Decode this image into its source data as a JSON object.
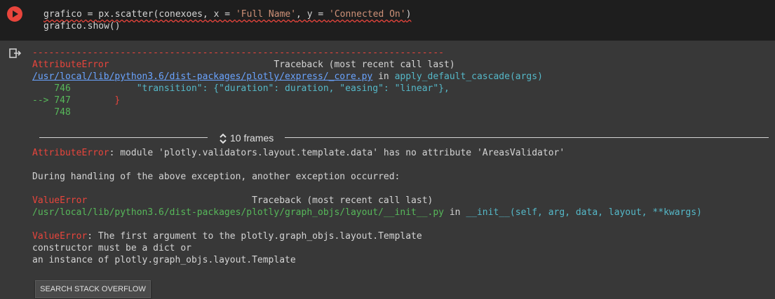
{
  "code_cell": {
    "line1": {
      "var": "grafico",
      "eq": " = ",
      "call": "px.scatter(conexoes, x = ",
      "xval": "'Full Name'",
      "mid": ", y = ",
      "yval": "'Connected On'",
      "end": ")"
    },
    "line2": "grafico.show()"
  },
  "traceback1": {
    "dashes": "---------------------------------------------------------------------------",
    "error_name": "AttributeError",
    "traceback_label": "                              Traceback (most recent call last)",
    "file_path": "/usr/local/lib/python3.6/dist-packages/plotly/express/_core.py",
    "in_word": " in ",
    "function": "apply_default_cascade(args)",
    "line746_num": "    746",
    "line746_code": "            \"transition\": {\"duration\": duration, \"easing\": \"linear\"},",
    "line747_arrow": "--> 747",
    "line747_code": "        }",
    "line748_num": "    748"
  },
  "frames_label": "10 frames",
  "error1": {
    "name": "AttributeError",
    "message": ": module 'plotly.validators.layout.template.data' has no attribute 'AreasValidator'"
  },
  "during_handling": "During handling of the above exception, another exception occurred:",
  "traceback2": {
    "error_name": "ValueError",
    "traceback_label": "                              Traceback (most recent call last)",
    "file_path": "/usr/local/lib/python3.6/dist-packages/plotly/graph_objs/layout/__init__.py",
    "in_word": " in ",
    "function": "__init__(self, arg, data, layout, **kwargs)"
  },
  "error2": {
    "name": "ValueError",
    "line1": ": The first argument to the plotly.graph_objs.layout.Template",
    "line2": "constructor must be a dict or",
    "line3": "an instance of plotly.graph_objs.layout.Template"
  },
  "search_button": "SEARCH STACK OVERFLOW",
  "colors": {
    "error_red": "#e8453c",
    "line_green": "#57b85a",
    "link_blue": "#6aa4ff",
    "path_cyan": "#55b8c8"
  }
}
